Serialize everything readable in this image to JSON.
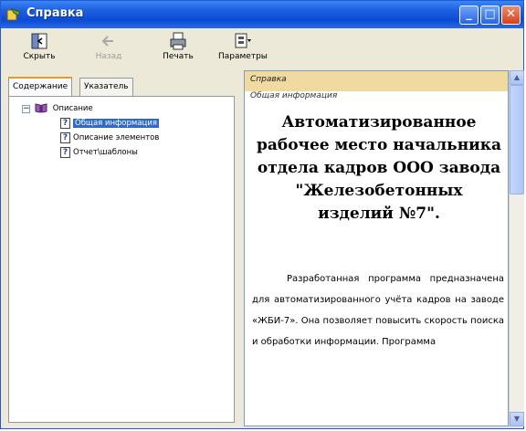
{
  "window": {
    "title": "Справка"
  },
  "titlebar_buttons": {
    "minimize": "_",
    "maximize": "□",
    "close": "✕"
  },
  "toolbar": {
    "hide_label": "Скрыть",
    "back_label": "Назад",
    "print_label": "Печать",
    "options_label": "Параметры"
  },
  "tabs": {
    "contents": "Содержание",
    "index": "Указатель"
  },
  "tree": {
    "root": {
      "label": "Описание",
      "expander": "−"
    },
    "items": [
      {
        "label": "Общая информация",
        "selected": true
      },
      {
        "label": "Описание элементов",
        "selected": false
      },
      {
        "label": "Отчет\\шаблоны",
        "selected": false
      }
    ]
  },
  "topic": {
    "breadcrumb_top": "Справка",
    "breadcrumb_sub": "Общая информация",
    "title": "Автоматизированное рабочее место начальника отдела кадров ООО завода \"Железобетонных изделий №7\".",
    "body": "Разработанная программа предназначена для автоматизированного учёта кадров на заводе «ЖБИ-7». Она позволяет повысить скорость поиска и обработки информации. Программа"
  },
  "colors": {
    "title_bar": "#0b4bd5",
    "breadcrumb_bg": "#f1d9a2",
    "selection": "#316ac5"
  }
}
